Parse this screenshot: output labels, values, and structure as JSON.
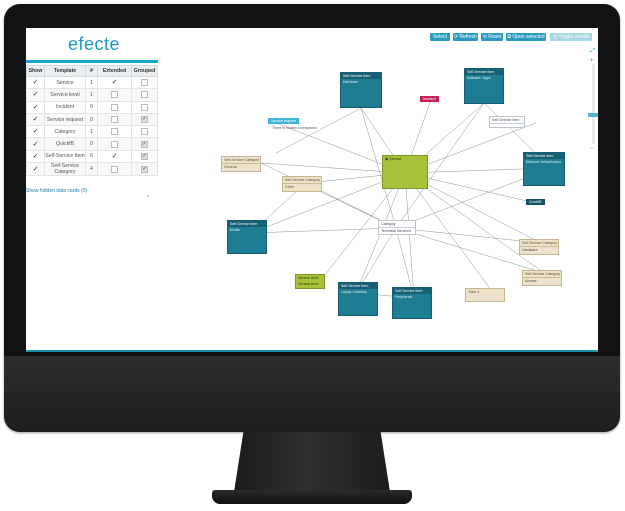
{
  "app": {
    "logo_text": "efecte",
    "accent": "#1a9bc0"
  },
  "template_table": {
    "headers": [
      "Show",
      "Template",
      "#",
      "Extended",
      "Grouped"
    ],
    "rows": [
      {
        "name": "Service",
        "count": "1",
        "show": true,
        "extended": true,
        "grouped": false
      },
      {
        "name": "Service level",
        "count": "1",
        "show": true,
        "extended": false,
        "grouped": false
      },
      {
        "name": "Incident",
        "count": "0",
        "show": true,
        "extended": false,
        "grouped": false
      },
      {
        "name": "Service request",
        "count": "0",
        "show": true,
        "extended": false,
        "grouped": true
      },
      {
        "name": "Category",
        "count": "1",
        "show": true,
        "extended": false,
        "grouped": false
      },
      {
        "name": "QuickfB",
        "count": "0",
        "show": true,
        "extended": false,
        "grouped": true
      },
      {
        "name": "Self-Service Item",
        "count": "6",
        "show": true,
        "extended": true,
        "grouped": true
      },
      {
        "name": "Self-Service Category",
        "count": "4",
        "show": true,
        "extended": false,
        "grouped": true
      }
    ],
    "hidden_link": "Show hidden data cards (0)"
  },
  "toolbar": {
    "select": "Select",
    "refresh": "Refresh",
    "reset": "Reset",
    "open_selected": "Open selected",
    "toggle_events": "Toggle events"
  },
  "graph": {
    "center_card": {
      "title": "Service"
    },
    "category_card": {
      "title": "Category",
      "body": "Technical Services"
    },
    "ssi_cards": [
      {
        "title": "Self-Service Item",
        "sub": "Hardware"
      },
      {
        "title": "Self-Service Item",
        "sub": "Software / Apps"
      },
      {
        "title": "Self-Service Item",
        "sub": "Network / Infrastructure"
      },
      {
        "title": "Self-Service Item",
        "sub": "Mobile"
      },
      {
        "title": "Self-Service Item",
        "sub": "Laptop / Desktop"
      },
      {
        "title": "Self-Service Item",
        "sub": "Peripherals"
      }
    ],
    "ssc_cards": [
      {
        "title": "Self-Service Category",
        "body": "General"
      },
      {
        "title": "Self-Service Category",
        "body": "Other"
      },
      {
        "title": "Self-Service Category",
        "body": "Hardware"
      },
      {
        "title": "Self-Service Category",
        "body": "Access"
      }
    ],
    "sl_card": {
      "title": "Service level",
      "body": "Service level"
    },
    "incident_label": "Incident",
    "request_label": "Service request",
    "request_note": "There is hidden connections",
    "dark_label": "QuickfB",
    "tiny_card": {
      "title": "Self-Service Item"
    },
    "tiny_note": "Total: 1"
  }
}
